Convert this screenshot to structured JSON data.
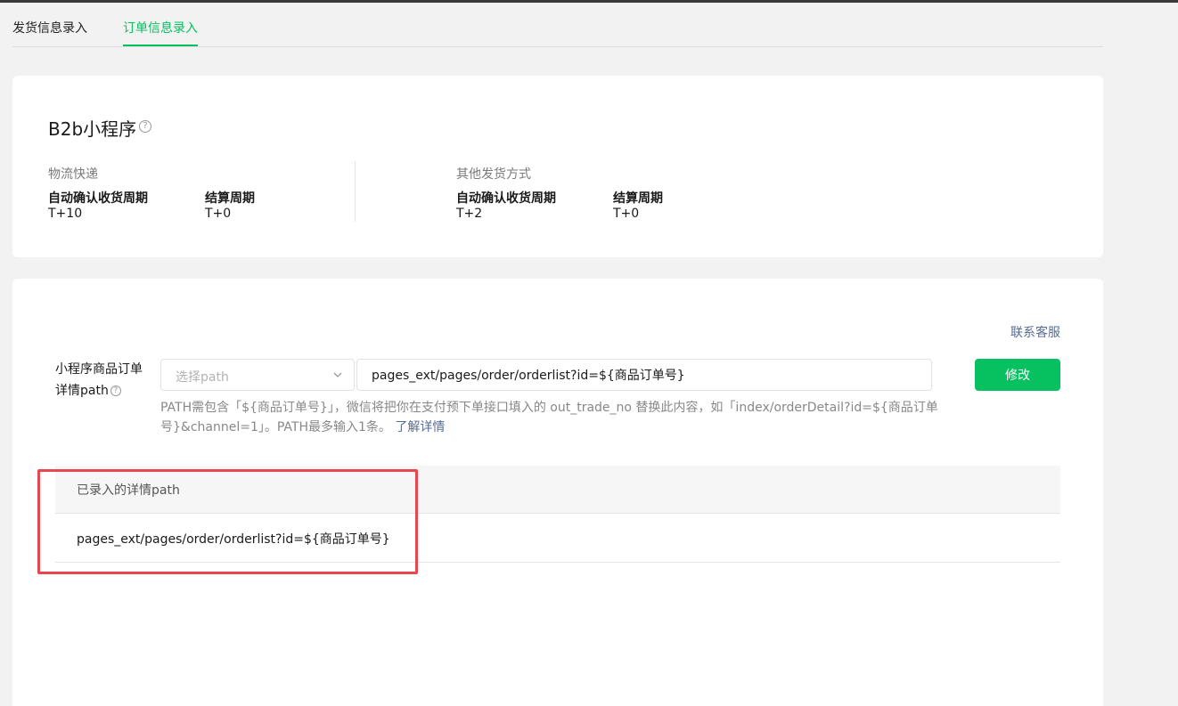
{
  "tabs": [
    {
      "label": "发货信息录入",
      "active": false
    },
    {
      "label": "订单信息录入",
      "active": true
    }
  ],
  "summary": {
    "title": "B2b小程序",
    "logistics": {
      "section": "物流快递",
      "fields": [
        {
          "label": "自动确认收货周期",
          "value": "T+10"
        },
        {
          "label": "结算周期",
          "value": "T+0"
        }
      ]
    },
    "other": {
      "section": "其他发货方式",
      "fields": [
        {
          "label": "自动确认收货周期",
          "value": "T+2"
        },
        {
          "label": "结算周期",
          "value": "T+0"
        }
      ]
    }
  },
  "path_form": {
    "contact_link": "联系客服",
    "label_line1": "小程序商品订单",
    "label_line2": "详情path",
    "select_placeholder": "选择path",
    "input_value": "pages_ext/pages/order/orderlist?id=${商品订单号}",
    "submit_label": "修改",
    "hint": "PATH需包含「${商品订单号}」，微信将把你在支付预下单接口填入的 out_trade_no 替换此内容，如「index/orderDetail?id=${商品订单号}&channel=1」。PATH最多输入1条。",
    "hint_link": "了解详情"
  },
  "recorded_table": {
    "header": "已录入的详情path",
    "rows": [
      "pages_ext/pages/order/orderlist?id=${商品订单号}"
    ]
  },
  "colors": {
    "accent": "#07c160",
    "link": "#576b95",
    "highlight": "#e8474e"
  },
  "icons": [
    "help-circle-icon",
    "chevron-down-icon"
  ]
}
